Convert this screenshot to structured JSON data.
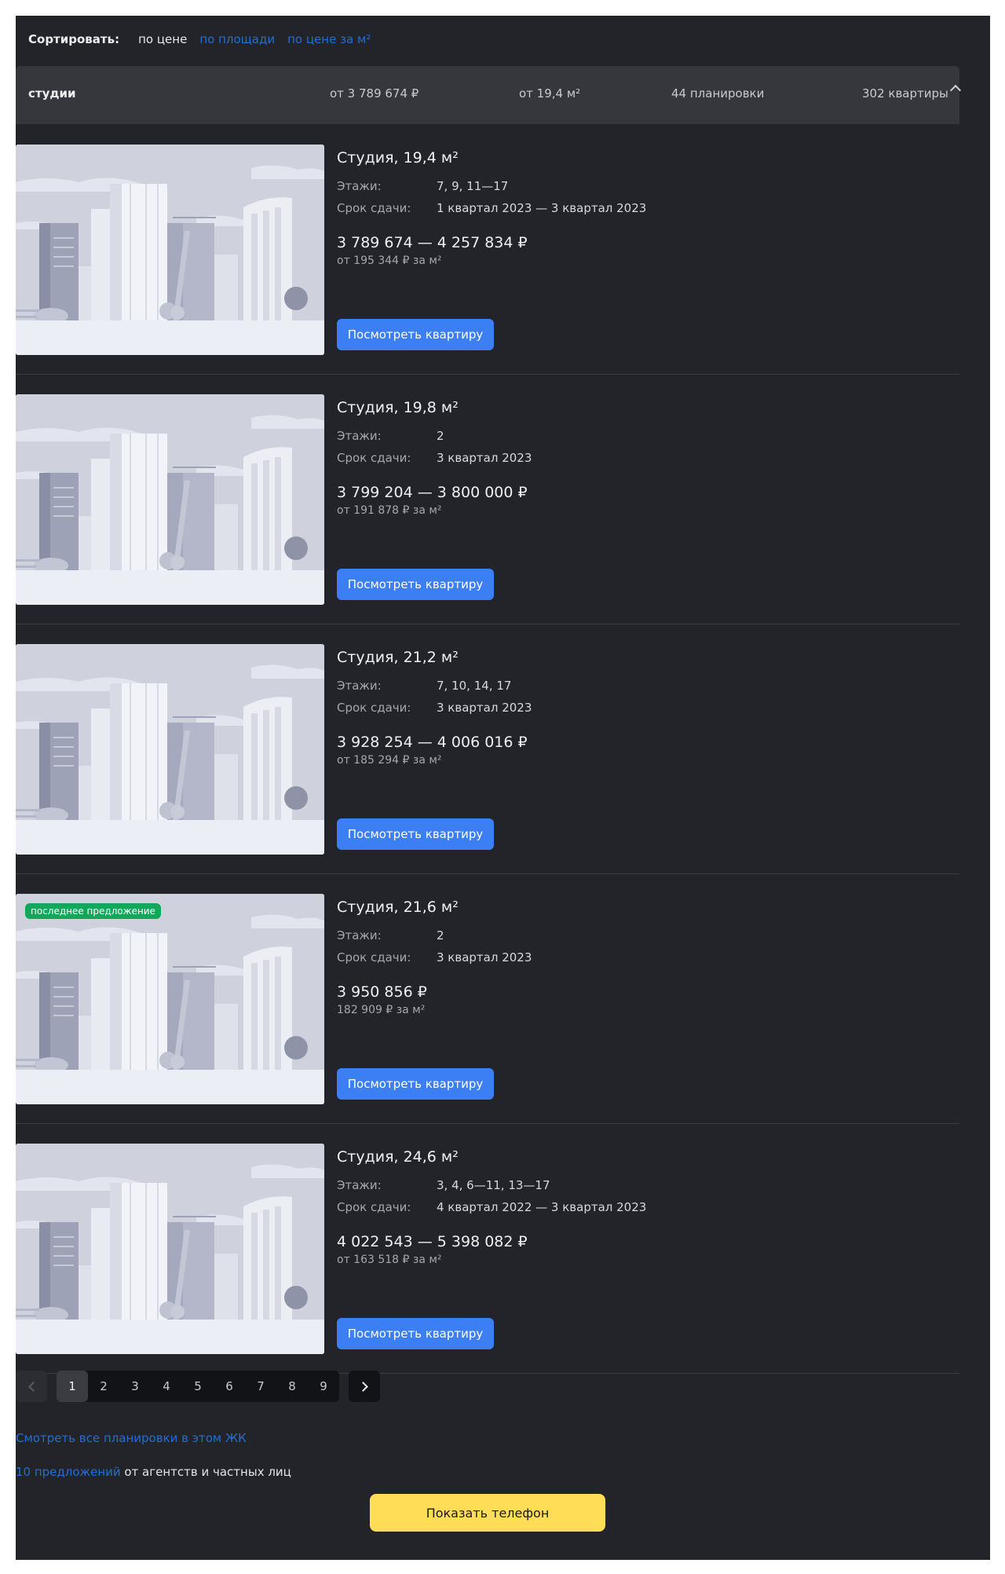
{
  "sort": {
    "label": "Сортировать:",
    "options": [
      "по цене",
      "по площади",
      "по цене за м²"
    ]
  },
  "group": {
    "title": "студии",
    "price_from": "от 3 789 674 ₽",
    "area_from": "от 19,4 м²",
    "plans": "44 планировки",
    "count": "302 квартиры"
  },
  "labels": {
    "floors": "Этажи:",
    "deadline": "Срок сдачи:",
    "view_button": "Посмотреть квартиру"
  },
  "items": [
    {
      "title": "Студия, 19,4 м²",
      "floors": "7, 9, 11—17",
      "deadline": "1 квартал 2023 — 3 квартал 2023",
      "price": "3 789 674 — 4 257 834 ₽",
      "price_per_m2": "от 195 344 ₽ за м²",
      "badge": ""
    },
    {
      "title": "Студия, 19,8 м²",
      "floors": "2",
      "deadline": "3 квартал 2023",
      "price": "3 799 204 — 3 800 000 ₽",
      "price_per_m2": "от 191 878 ₽ за м²",
      "badge": ""
    },
    {
      "title": "Студия, 21,2 м²",
      "floors": "7, 10, 14, 17",
      "deadline": "3 квартал 2023",
      "price": "3 928 254 — 4 006 016 ₽",
      "price_per_m2": "от 185 294 ₽ за м²",
      "badge": ""
    },
    {
      "title": "Студия, 21,6 м²",
      "floors": "2",
      "deadline": "3 квартал 2023",
      "price": "3 950 856 ₽",
      "price_per_m2": "182 909 ₽ за м²",
      "badge": "последнее предложение"
    },
    {
      "title": "Студия, 24,6 м²",
      "floors": "3, 4, 6—11, 13—17",
      "deadline": "4 квартал 2022 — 3 квартал 2023",
      "price": "4 022 543 — 5 398 082 ₽",
      "price_per_m2": "от 163 518 ₽ за м²",
      "badge": ""
    }
  ],
  "pagination": {
    "pages": [
      "1",
      "2",
      "3",
      "4",
      "5",
      "6",
      "7",
      "8",
      "9"
    ],
    "current": "1"
  },
  "footer": {
    "all_plans_link": "Смотреть все планировки в этом ЖК",
    "offers_link": "10 предложений",
    "offers_text": " от агентств и частных лиц",
    "phone_button": "Показать телефон"
  },
  "colors": {
    "panel_bg": "#232429",
    "accent_button": "#3c7ff5",
    "phone_button": "#ffdd57",
    "link": "#1f6fd6",
    "badge": "#11a85a"
  }
}
